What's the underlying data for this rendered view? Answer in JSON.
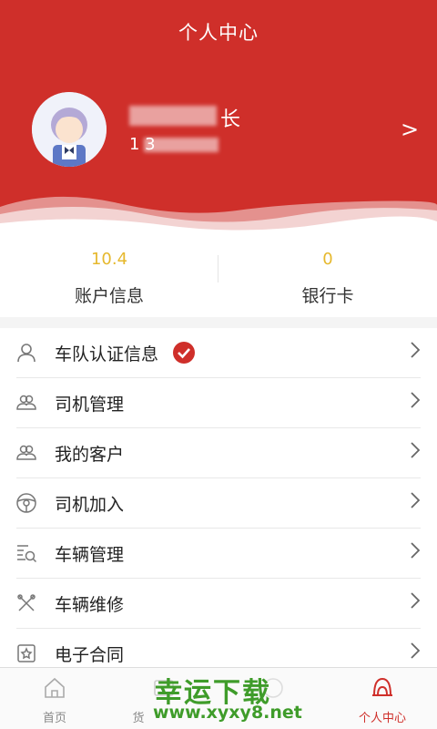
{
  "header": {
    "title": "个人中心"
  },
  "profile": {
    "name": "长",
    "phone": "1     3",
    "arrow": ">"
  },
  "stats": [
    {
      "value": "10.4",
      "label": "账户信息"
    },
    {
      "value": "0",
      "label": "银行卡"
    }
  ],
  "menu": [
    {
      "label": "车队认证信息",
      "icon": "person-icon",
      "verified": true
    },
    {
      "label": "司机管理",
      "icon": "group-icon"
    },
    {
      "label": "我的客户",
      "icon": "group-icon"
    },
    {
      "label": "司机加入",
      "icon": "steering-wheel-icon"
    },
    {
      "label": "车辆管理",
      "icon": "list-search-icon"
    },
    {
      "label": "车辆维修",
      "icon": "wrench-icon"
    },
    {
      "label": "电子合同",
      "icon": "contract-icon"
    }
  ],
  "tabbar": [
    {
      "label": "首页",
      "icon": "home-icon"
    },
    {
      "label": "货",
      "icon": "cargo-icon"
    },
    {
      "label": "",
      "icon": "message-icon"
    },
    {
      "label": "个人中心",
      "icon": "profile-icon",
      "active": true
    }
  ],
  "watermark": {
    "title": "幸运下载",
    "url": "www.xyxy8.net"
  },
  "colors": {
    "brand": "#cf2f2a",
    "value": "#e6b82d",
    "watermark": "#3f9c2a"
  }
}
